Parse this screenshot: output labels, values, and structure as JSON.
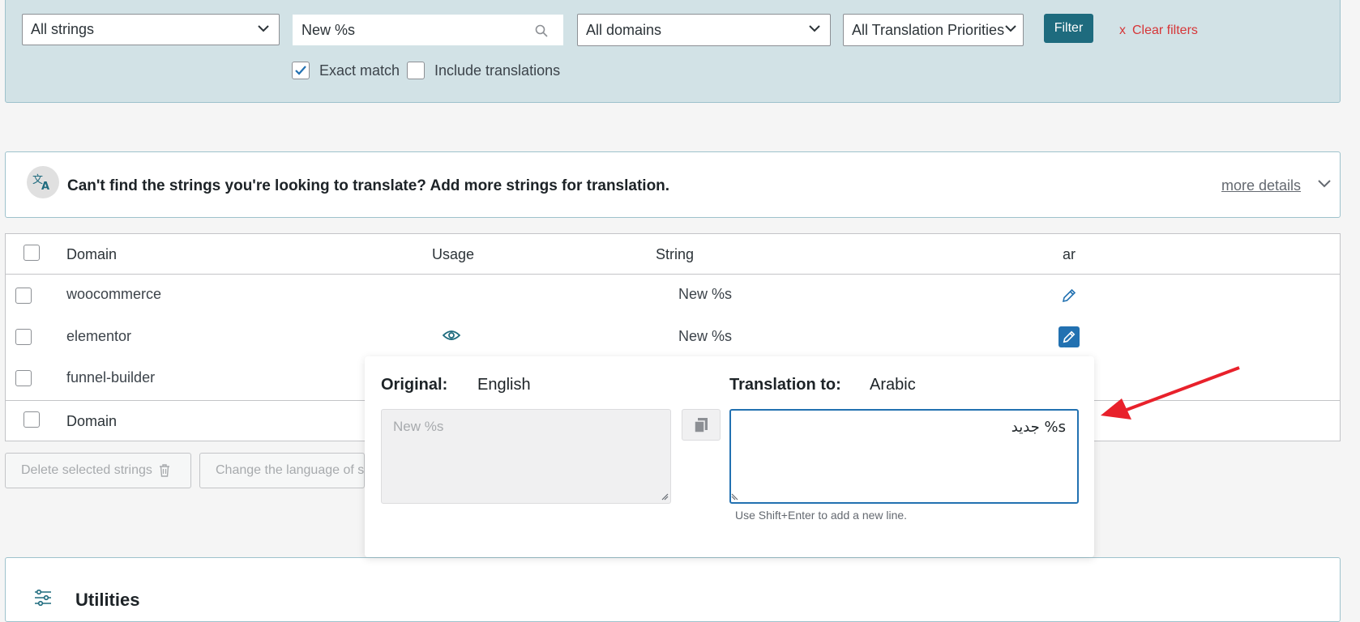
{
  "filters": {
    "string_type": "All strings",
    "search_value": "New %s",
    "domains": "All domains",
    "priorities": "All Translation Priorities",
    "filter_label": "Filter",
    "clear_x": "x",
    "clear_label": "Clear filters",
    "exact_match_label": "Exact match",
    "exact_match_checked": true,
    "include_translations_label": "Include translations",
    "include_translations_checked": false
  },
  "notice": {
    "text": "Can't find the strings you're looking to translate? Add more strings for translation.",
    "more_details": "more details"
  },
  "table": {
    "headers": {
      "domain": "Domain",
      "usage": "Usage",
      "string": "String",
      "lang": "ar"
    },
    "rows": [
      {
        "domain": "woocommerce",
        "string": "New %s"
      },
      {
        "domain": "elementor",
        "string": "New %s"
      },
      {
        "domain": "funnel-builder",
        "string": ""
      }
    ],
    "footer_domain": "Domain"
  },
  "bulk_actions": {
    "delete_label": "Delete selected strings",
    "change_language_label": "Change the language of s"
  },
  "popup": {
    "original_label": "Original:",
    "original_lang": "English",
    "translation_label": "Translation to:",
    "translation_lang": "Arabic",
    "original_text": "New %s",
    "translation_text": "s% جديد",
    "hint": "Use Shift+Enter to add a new line."
  },
  "utilities": {
    "title": "Utilities"
  },
  "colors": {
    "accent": "#2271b1",
    "filter_button": "#1e6b7e",
    "panel_bg": "#d2e2e6",
    "clear_filters": "#d63638",
    "annotation_arrow": "#e8212b"
  }
}
